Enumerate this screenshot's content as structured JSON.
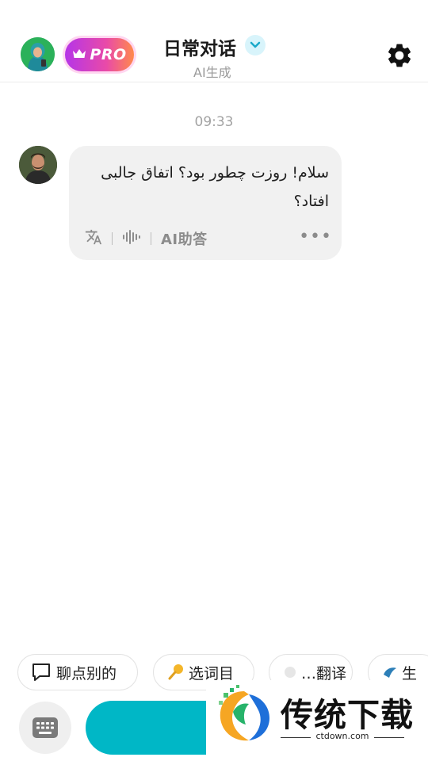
{
  "header": {
    "title": "日常对话",
    "subtitle": "AI生成",
    "pro_label": "PRO"
  },
  "chat": {
    "timestamp": "09:33",
    "messages": [
      {
        "text": "سلام! روزت چطور بود؟ اتفاق جالبی افتاد؟",
        "ai_answer_label": "AI助答"
      }
    ]
  },
  "suggestions": [
    {
      "label": "聊点别的",
      "icon": "speech-bubble-icon"
    },
    {
      "label": "选词目",
      "icon": "pin-icon"
    },
    {
      "label": "…翻译",
      "icon": "chip-icon"
    },
    {
      "label": "生",
      "icon": "bird-icon"
    }
  ],
  "input": {
    "keyboard_icon": "keyboard-icon"
  },
  "watermark": {
    "text": "传统下载",
    "url": "ctdown.com"
  },
  "colors": {
    "accent": "#00b7c6",
    "pro_gradient_start": "#b535e8",
    "pro_gradient_end": "#ff8a4c",
    "bubble_bg": "#f1f1f1"
  }
}
